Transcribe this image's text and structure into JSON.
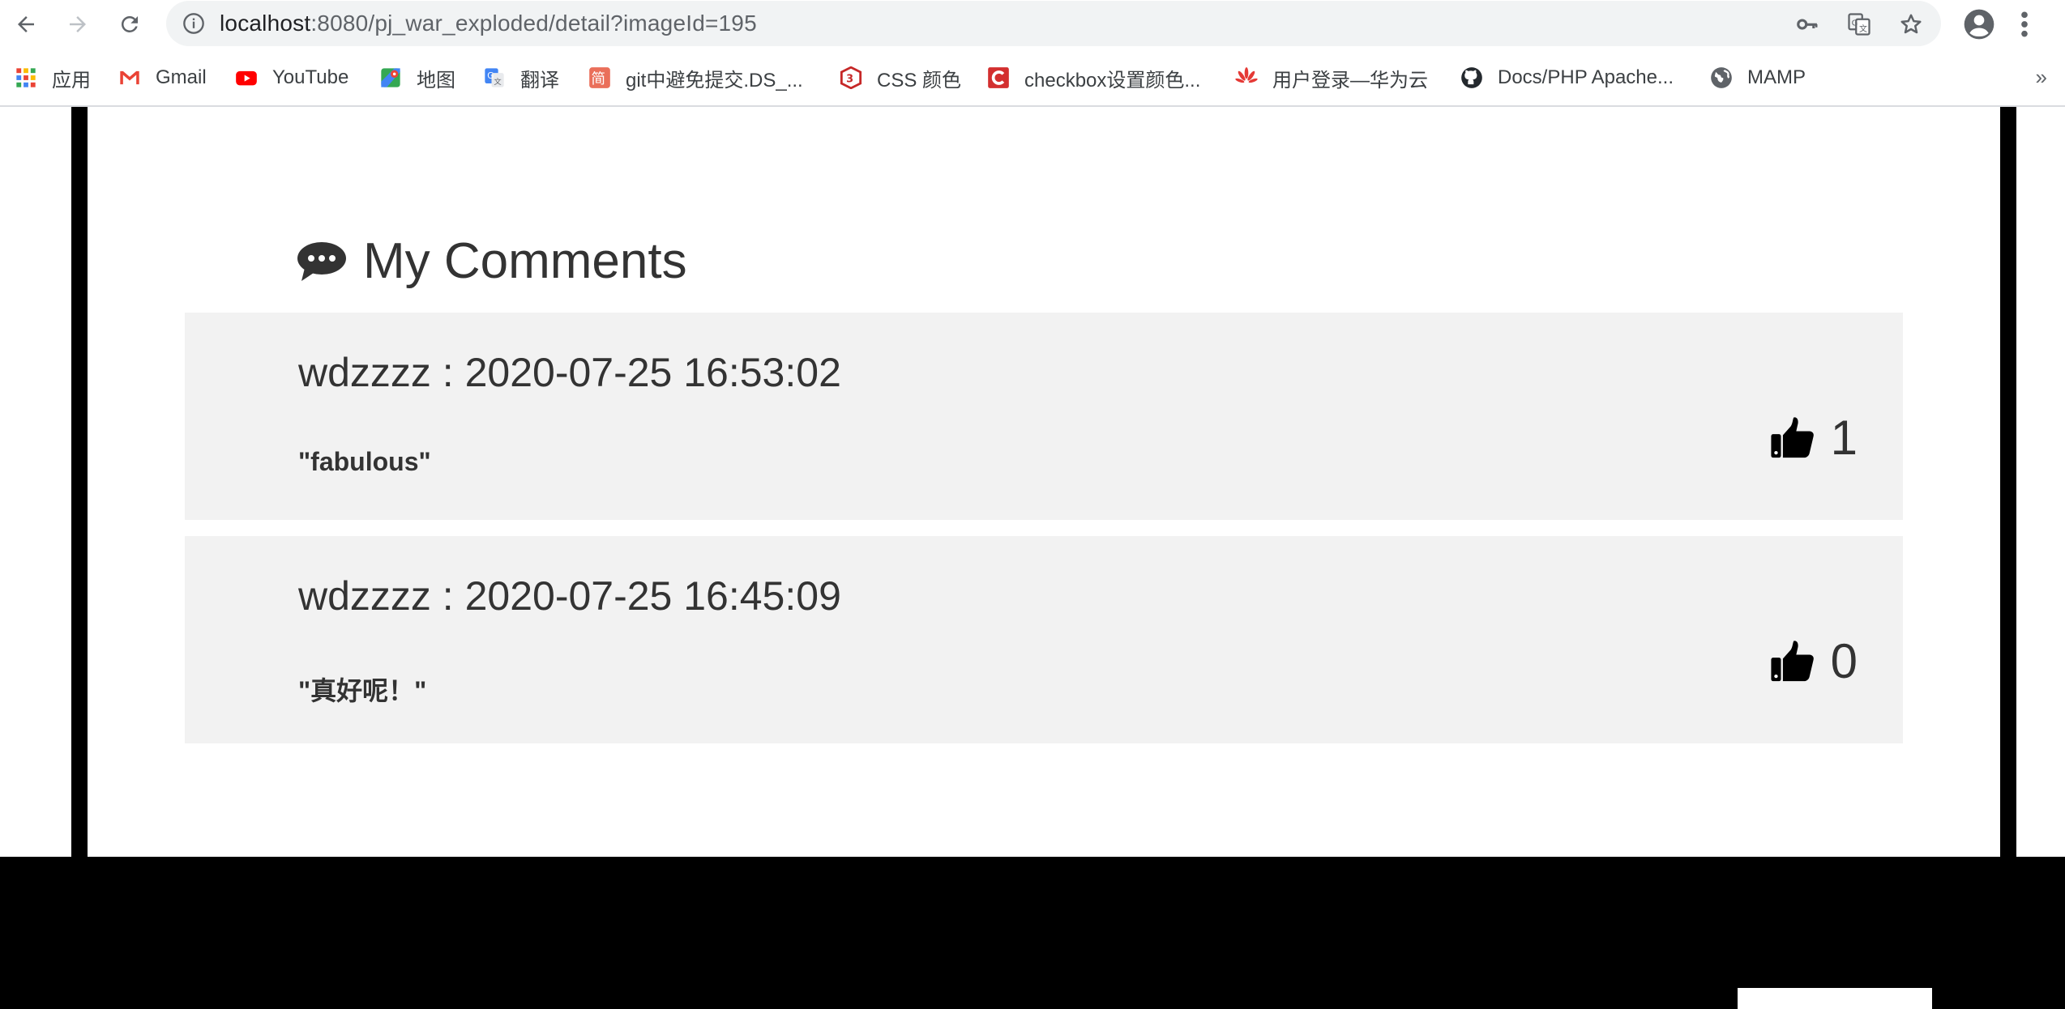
{
  "browser": {
    "url_host": "localhost",
    "url_rest": ":8080/pj_war_exploded/detail?imageId=195",
    "bookmarks": [
      {
        "label": "应用",
        "icon": "apps-grid-icon"
      },
      {
        "label": "Gmail",
        "icon": "gmail-icon"
      },
      {
        "label": "YouTube",
        "icon": "youtube-icon"
      },
      {
        "label": "地图",
        "icon": "maps-icon"
      },
      {
        "label": "翻译",
        "icon": "translate-icon"
      },
      {
        "label": "git中避免提交.DS_...",
        "icon": "jianshu-icon"
      },
      {
        "label": "CSS 颜色",
        "icon": "w3c-icon"
      },
      {
        "label": "checkbox设置颜色...",
        "icon": "csdn-icon"
      },
      {
        "label": "用户登录—华为云",
        "icon": "huawei-icon"
      },
      {
        "label": "Docs/PHP Apache...",
        "icon": "github-icon"
      },
      {
        "label": "MAMP",
        "icon": "globe-icon"
      }
    ],
    "more": "»"
  },
  "comments_section": {
    "title": "My Comments",
    "comments": [
      {
        "user": "wdzzzz",
        "time": "2020-07-25 16:53:02",
        "meta": "wdzzzz : 2020-07-25 16:53:02",
        "text": "\"fabulous\"",
        "likes": "1"
      },
      {
        "user": "wdzzzz",
        "time": "2020-07-25 16:45:09",
        "meta": "wdzzzz : 2020-07-25 16:45:09",
        "text": "\"真好呢！\"",
        "likes": "0"
      }
    ]
  },
  "colors": {
    "frame": "#000000",
    "card_bg": "#f2f2f2",
    "text": "#333333",
    "footer": "#000000"
  }
}
